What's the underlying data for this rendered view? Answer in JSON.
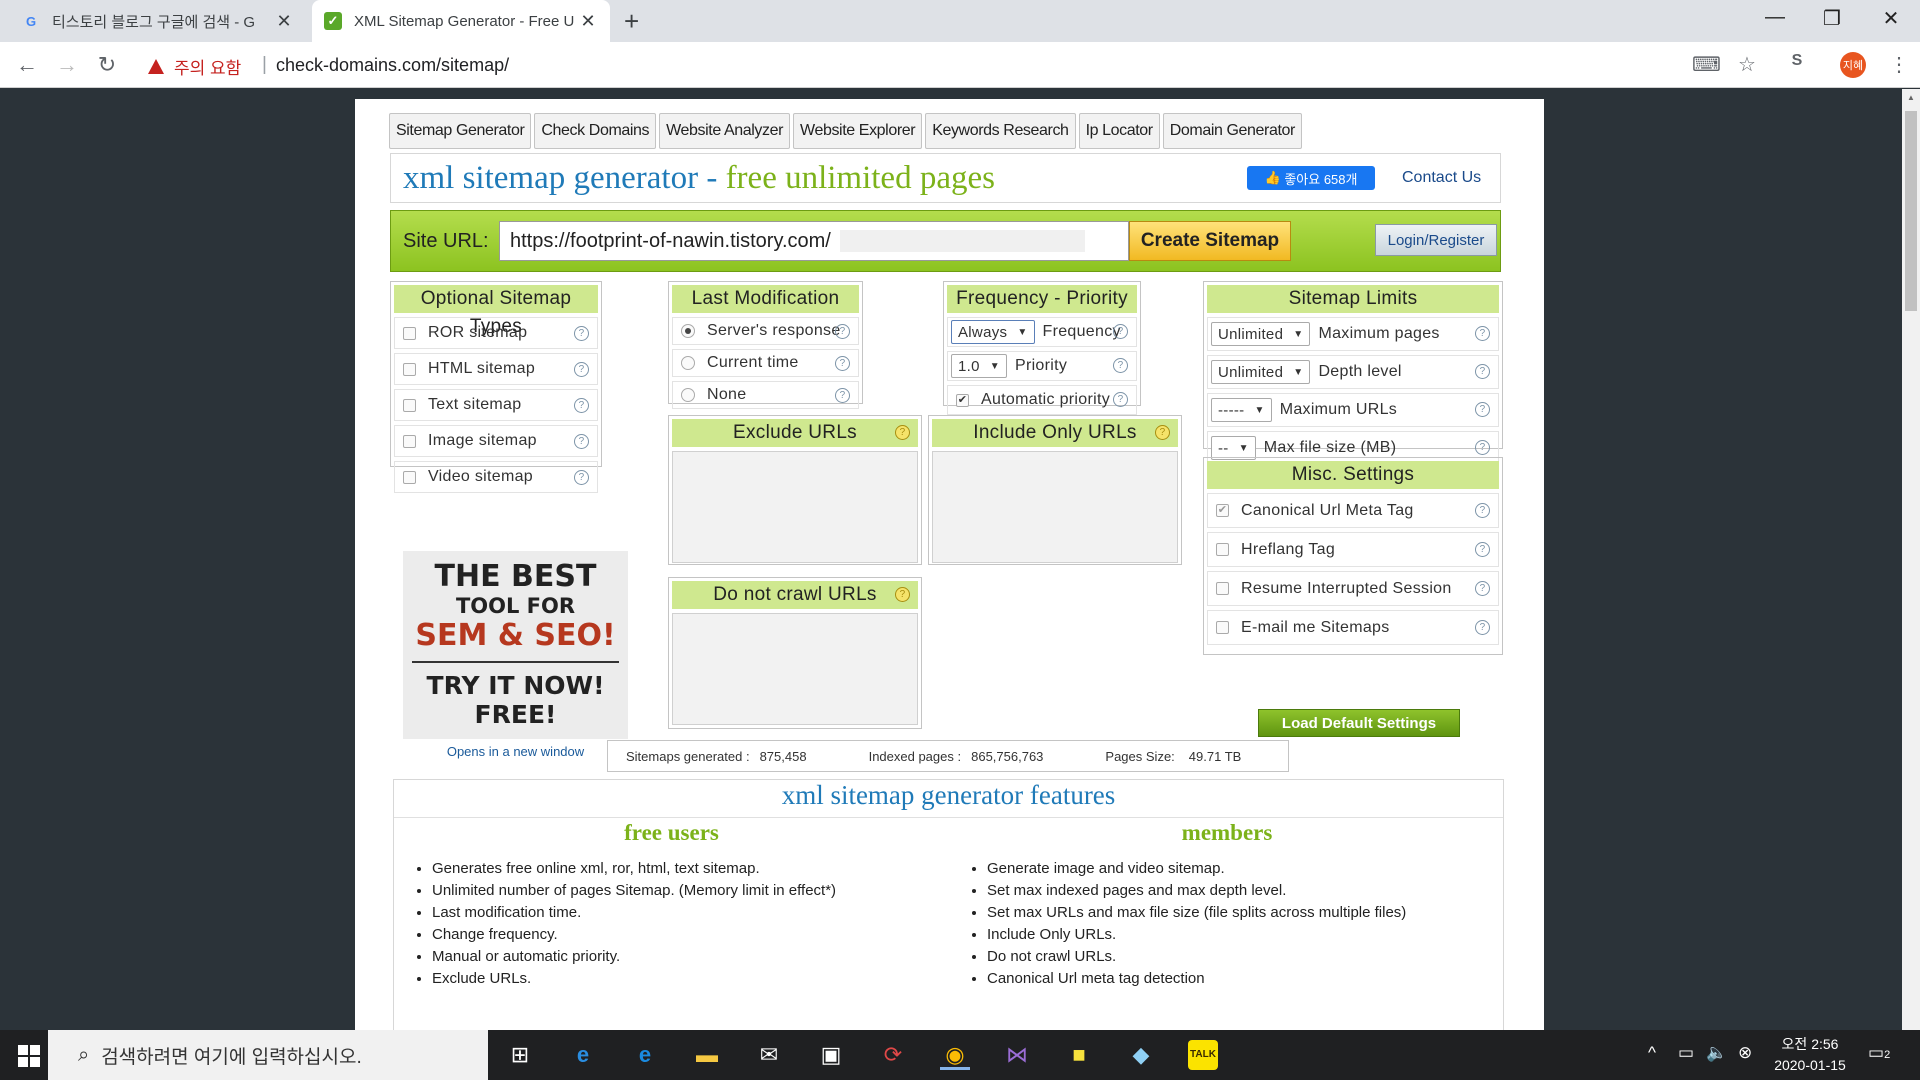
{
  "browser": {
    "tabs": [
      {
        "title": "티스토리 블로그 구글에 검색 - G",
        "favicon": "google-icon"
      },
      {
        "title": "XML Sitemap Generator - Free U",
        "favicon": "sitemap-icon"
      }
    ],
    "security_label": "주의 요함",
    "url": "check-domains.com/sitemap/",
    "profile_initial": "지혜"
  },
  "site": {
    "menu": [
      "Sitemap Generator",
      "Check Domains",
      "Website Analyzer",
      "Website Explorer",
      "Keywords Research",
      "Ip Locator",
      "Domain Generator"
    ],
    "title_blue": "xml sitemap generator - ",
    "title_green": "free unlimited pages",
    "fb_like": "좋아요 658개",
    "contact": "Contact Us",
    "url_label": "Site URL:",
    "url_value": "https://footprint-of-nawin.tistory.com/",
    "create_button": "Create Sitemap",
    "login_button": "Login/Register",
    "optional_types": {
      "header": "Optional Sitemap Types",
      "items": [
        {
          "label": "ROR sitemap",
          "checked": false
        },
        {
          "label": "HTML sitemap",
          "checked": false
        },
        {
          "label": "Text sitemap",
          "checked": false
        },
        {
          "label": "Image sitemap",
          "checked": false
        },
        {
          "label": "Video sitemap",
          "checked": false
        }
      ]
    },
    "last_modification": {
      "header": "Last Modification",
      "items": [
        {
          "label": "Server's response",
          "selected": true
        },
        {
          "label": "Current time",
          "selected": false
        },
        {
          "label": "None",
          "selected": false
        }
      ]
    },
    "frequency_priority": {
      "header": "Frequency - Priority",
      "frequency_value": "Always",
      "frequency_label": "Frequency",
      "priority_value": "1.0",
      "priority_label": "Priority",
      "auto_priority_label": "Automatic priority",
      "auto_priority_checked": true
    },
    "sitemap_limits": {
      "header": "Sitemap Limits",
      "items": [
        {
          "value": "Unlimited",
          "label": "Maximum pages"
        },
        {
          "value": "Unlimited",
          "label": "Depth level"
        },
        {
          "value": "-----",
          "label": "Maximum URLs"
        },
        {
          "value": "--",
          "label": "Max file size (MB)"
        }
      ]
    },
    "exclude_header": "Exclude URLs",
    "include_header": "Include Only URLs",
    "nocrawl_header": "Do not crawl URLs",
    "misc": {
      "header": "Misc. Settings",
      "items": [
        {
          "label": "Canonical Url Meta Tag",
          "checked": true
        },
        {
          "label": "Hreflang Tag",
          "checked": false
        },
        {
          "label": "Resume Interrupted Session",
          "checked": false
        },
        {
          "label": "E-mail me Sitemaps",
          "checked": false
        }
      ]
    },
    "default_button": "Load Default Settings",
    "ad": {
      "line1": "THE BEST",
      "line2": "TOOL FOR",
      "line3": "SEM & SEO!",
      "line4": "TRY IT NOW!",
      "line5": "FREE!",
      "note": "Opens in a new window"
    },
    "stats": {
      "generated_label": "Sitemaps generated :",
      "generated_value": "875,458",
      "indexed_label": "Indexed pages :",
      "indexed_value": "865,756,763",
      "size_label": "Pages Size:",
      "size_value": "49.71 TB"
    },
    "features": {
      "title": "xml sitemap generator features",
      "free_title": "free users",
      "free_items": [
        "Generates free online xml, ror, html, text sitemap.",
        "Unlimited number of pages Sitemap. (Memory limit in effect*)",
        "Last modification time.",
        "Change frequency.",
        "Manual or automatic priority.",
        "Exclude URLs."
      ],
      "members_title": "members",
      "members_items": [
        "Generate image and video sitemap.",
        "Set max indexed pages and max depth level.",
        "Set max URLs and max file size (file splits across multiple files)",
        "Include Only URLs.",
        "Do not crawl URLs.",
        "Canonical Url meta tag detection"
      ]
    }
  },
  "taskbar": {
    "search_placeholder": "검색하려면 여기에 입력하십시오.",
    "time": "오전 2:56",
    "date": "2020-01-15",
    "notifications": "2"
  }
}
